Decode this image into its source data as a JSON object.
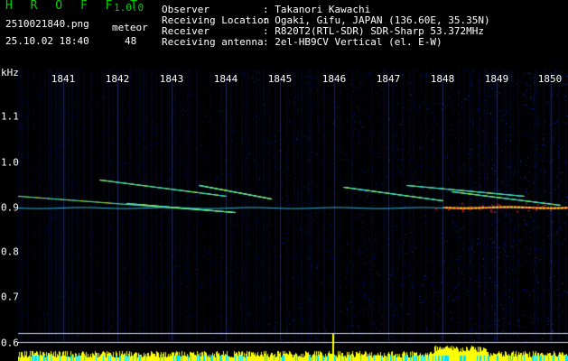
{
  "header": {
    "app_title": "H R O F F T",
    "version": "1.0.0",
    "file_name": "2510021840.png",
    "datetime": "25.10.02 18:40",
    "meteor_label": "meteor",
    "meteor_count": "48",
    "info": [
      {
        "label": "Observer",
        "value": ": Takanori Kawachi"
      },
      {
        "label": "Receiving Location",
        "value": ": Ogaki, Gifu, JAPAN (136.60E, 35.35N)"
      },
      {
        "label": "Receiver",
        "value": ": R820T2(RTL-SDR) SDR-Sharp 53.372MHz"
      },
      {
        "label": "Receiving antenna",
        "value": ": 2el-HB9CV Vertical (el. E-W)"
      }
    ]
  },
  "spectrogram": {
    "y_unit": "kHz",
    "y_ticks": [
      "1.1",
      "1.0",
      "0.9",
      "0.8",
      "0.7",
      "0.6"
    ],
    "x_ticks": [
      "1841",
      "1842",
      "1843",
      "1844",
      "1845",
      "1846",
      "1847",
      "1848",
      "1849",
      "1850"
    ]
  },
  "colors": {
    "background": "#000000",
    "title": "#00d000",
    "noise": "#0a1ea0",
    "signal_yellow": "#ffff00",
    "signal_cyan": "#00ffff"
  }
}
